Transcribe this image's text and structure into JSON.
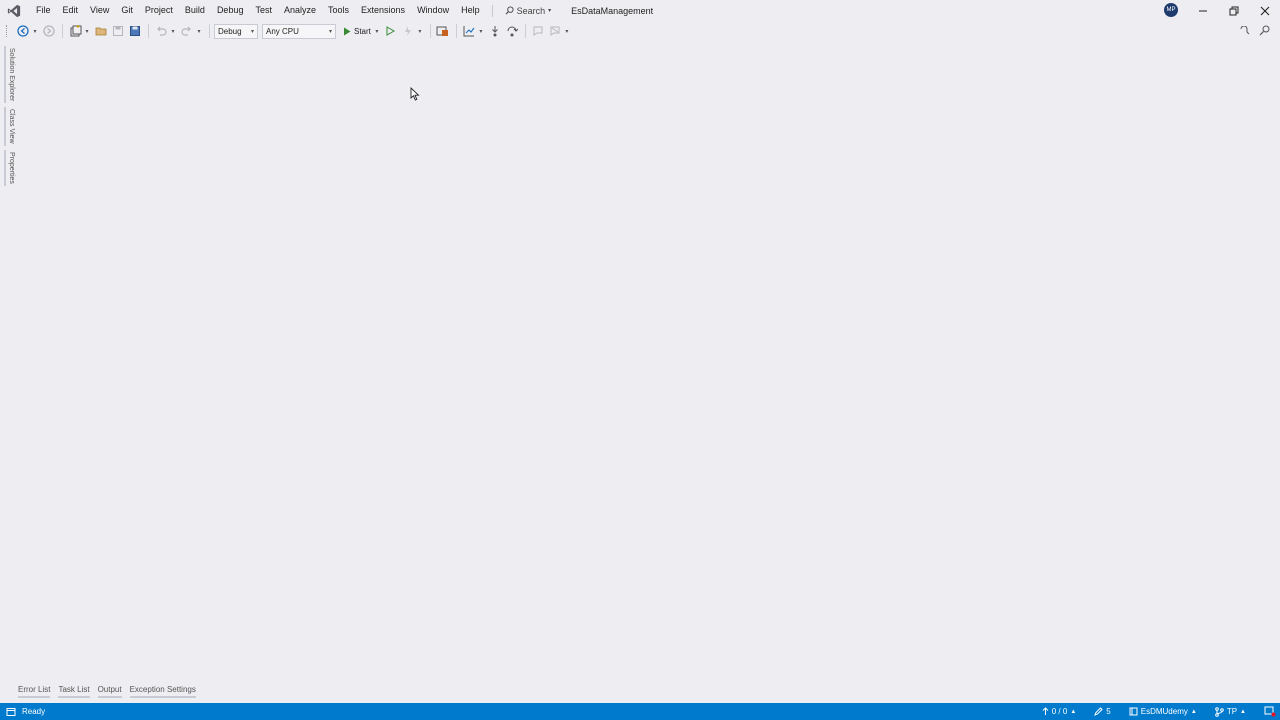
{
  "menu": {
    "items": [
      "File",
      "Edit",
      "View",
      "Git",
      "Project",
      "Build",
      "Debug",
      "Test",
      "Analyze",
      "Tools",
      "Extensions",
      "Window",
      "Help"
    ],
    "search_label": "Search",
    "solution_name": "EsDataManagement"
  },
  "account": {
    "initials": "MP"
  },
  "toolbar": {
    "configuration": "Debug",
    "platform": "Any CPU",
    "start_label": "Start"
  },
  "side_tabs": [
    "Solution Explorer",
    "Class View",
    "Properties"
  ],
  "bottom_tabs": [
    "Error List",
    "Task List",
    "Output",
    "Exception Settings"
  ],
  "status": {
    "ready": "Ready",
    "source_control_counts": "0 / 0",
    "pending_changes": "5",
    "repository": "EsDMUdemy",
    "branch": "TP"
  },
  "colors": {
    "background": "#eeeef2",
    "statusbar": "#007acc",
    "vs_purple": "#68217a",
    "start_green": "#388a34"
  }
}
